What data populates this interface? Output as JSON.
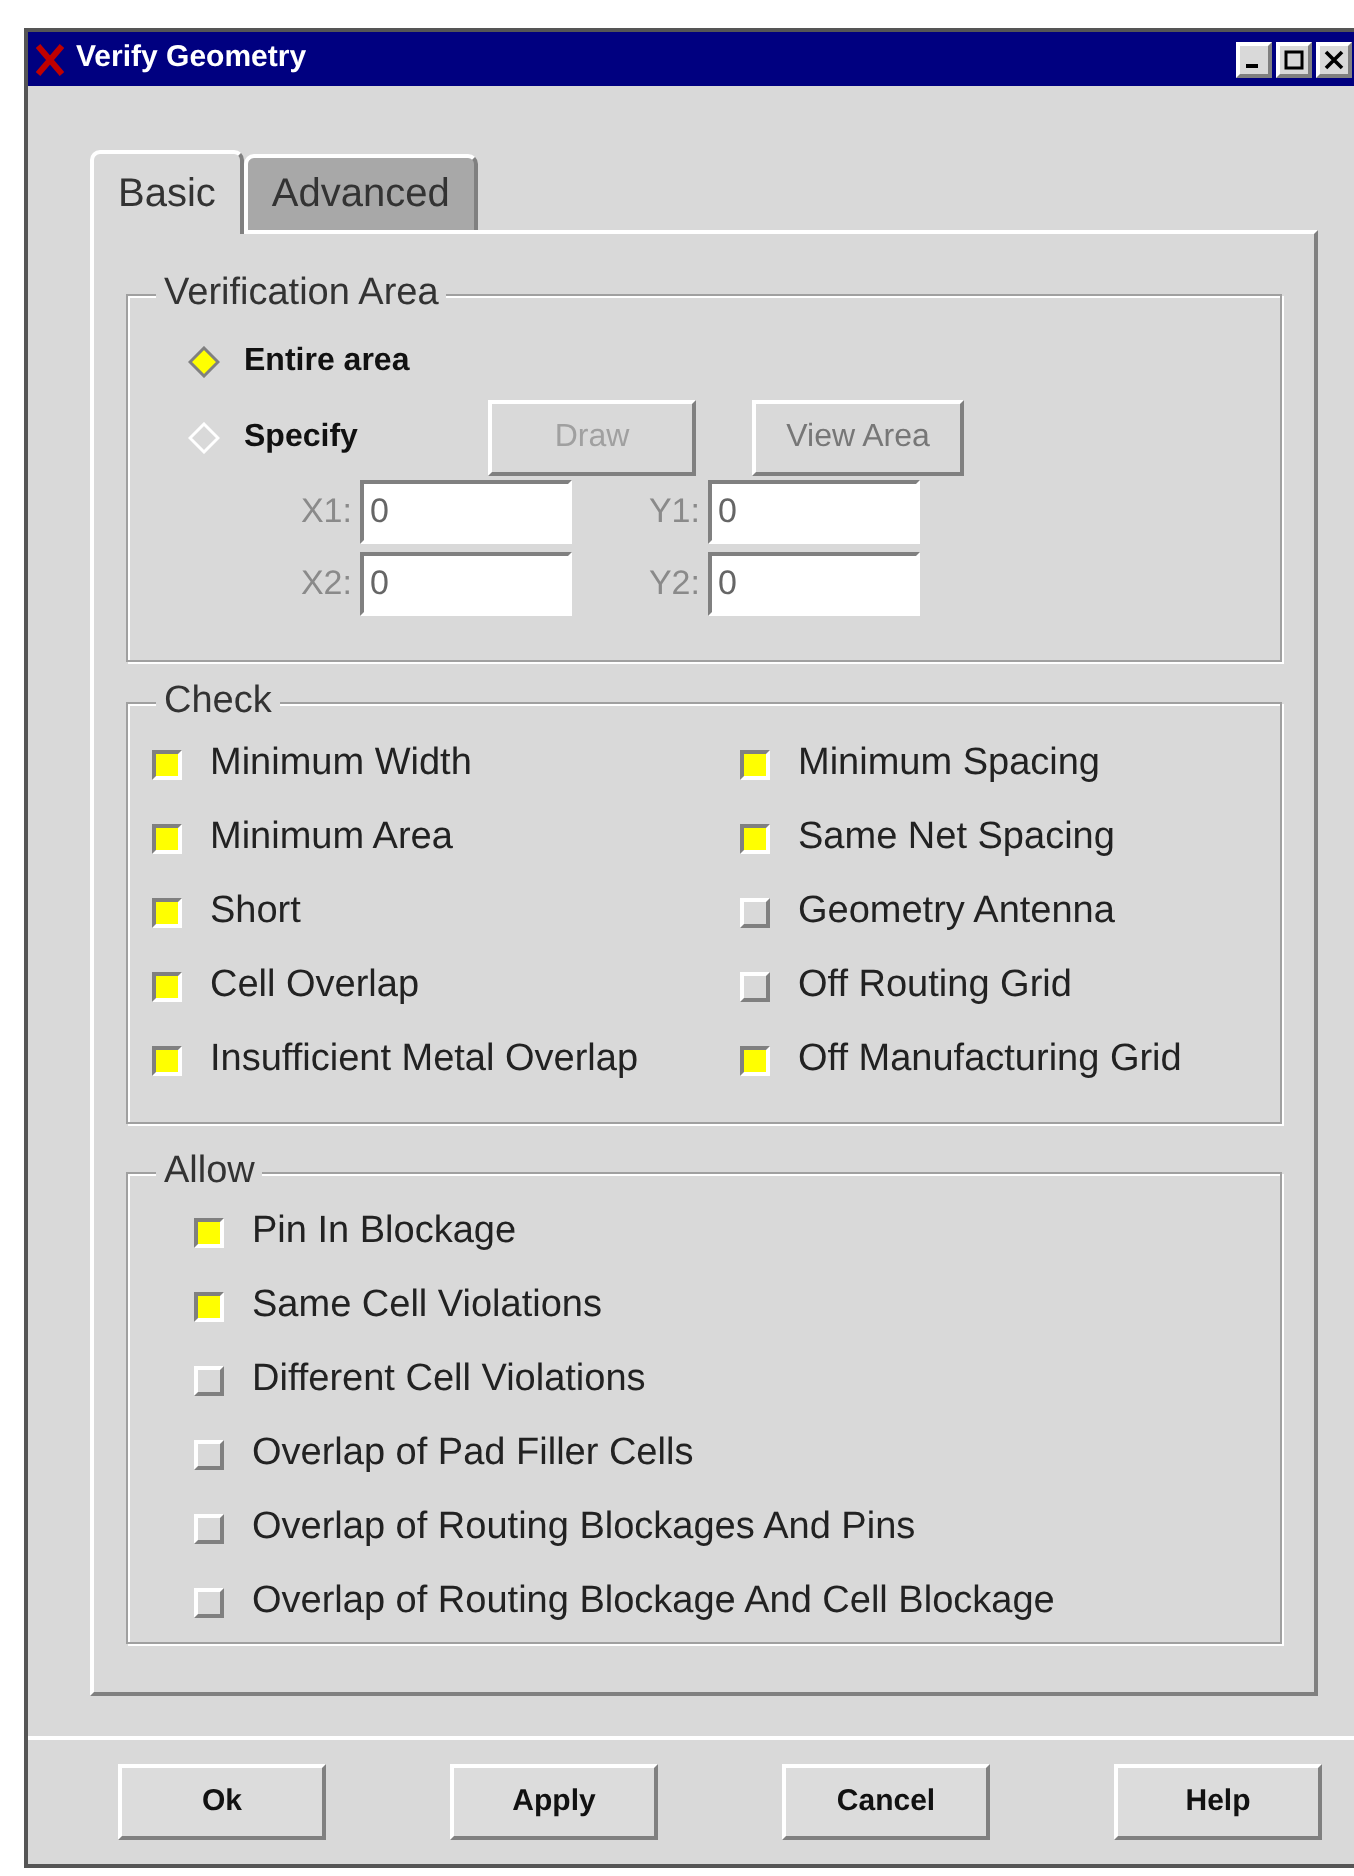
{
  "window": {
    "title": "Verify Geometry"
  },
  "tabs": [
    {
      "label": "Basic",
      "selected": true
    },
    {
      "label": "Advanced",
      "selected": false
    }
  ],
  "verification_area": {
    "title": "Verification Area",
    "options": [
      {
        "label": "Entire area",
        "selected": true
      },
      {
        "label": "Specify",
        "selected": false
      }
    ],
    "buttons": [
      {
        "label": "Draw",
        "disabled": true
      },
      {
        "label": "View Area",
        "disabled": false
      }
    ],
    "fields": [
      {
        "label": "X1:",
        "value": "0",
        "disabled": true
      },
      {
        "label": "Y1:",
        "value": "0",
        "disabled": true
      },
      {
        "label": "X2:",
        "value": "0",
        "disabled": true
      },
      {
        "label": "Y2:",
        "value": "0",
        "disabled": true
      }
    ]
  },
  "check": {
    "title": "Check",
    "items": [
      {
        "label": "Minimum Width",
        "checked": true
      },
      {
        "label": "Minimum Spacing",
        "checked": true
      },
      {
        "label": "Minimum Area",
        "checked": true
      },
      {
        "label": "Same Net Spacing",
        "checked": true
      },
      {
        "label": "Short",
        "checked": true
      },
      {
        "label": "Geometry Antenna",
        "checked": false
      },
      {
        "label": "Cell Overlap",
        "checked": true
      },
      {
        "label": "Off Routing Grid",
        "checked": false
      },
      {
        "label": "Insufficient Metal Overlap",
        "checked": true
      },
      {
        "label": "Off Manufacturing Grid",
        "checked": true
      }
    ]
  },
  "allow": {
    "title": "Allow",
    "items": [
      {
        "label": "Pin In Blockage",
        "checked": true
      },
      {
        "label": "Same Cell Violations",
        "checked": true
      },
      {
        "label": "Different Cell Violations",
        "checked": false
      },
      {
        "label": "Overlap of Pad Filler Cells",
        "checked": false
      },
      {
        "label": "Overlap of Routing Blockages And Pins",
        "checked": false
      },
      {
        "label": "Overlap of Routing Blockage And Cell Blockage",
        "checked": false
      }
    ]
  },
  "buttons": [
    "Ok",
    "Apply",
    "Cancel",
    "Help"
  ]
}
